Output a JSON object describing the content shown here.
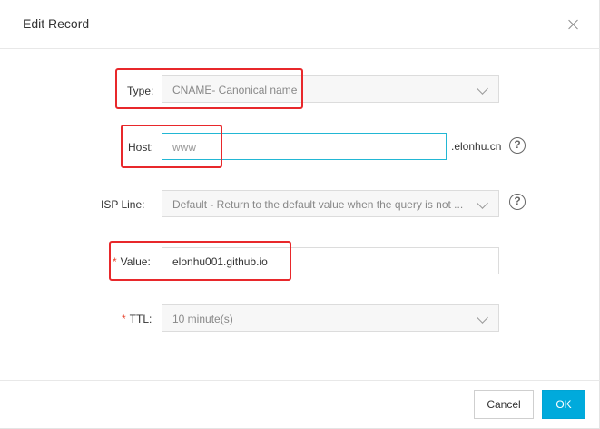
{
  "dialog": {
    "title": "Edit Record",
    "close_icon": "close-icon"
  },
  "form": {
    "type": {
      "label": "Type:",
      "value": "CNAME- Canonical name"
    },
    "host": {
      "label": "Host:",
      "value": "www",
      "suffix": ".elonhu.cn",
      "help_icon": "help-icon"
    },
    "isp_line": {
      "label": "ISP Line:",
      "value": "Default - Return to the default value when the query is not ...",
      "help_icon": "help-icon"
    },
    "value": {
      "required_mark": "*",
      "label": "Value:",
      "value": "elonhu001.github.io"
    },
    "ttl": {
      "required_mark": "*",
      "label": "TTL:",
      "value": "10 minute(s)"
    }
  },
  "footer": {
    "cancel_label": "Cancel",
    "ok_label": "OK"
  },
  "colors": {
    "accent": "#00aadc",
    "focus_border": "#22b7d4",
    "required": "#e6442e",
    "annotation": "#e8282b"
  }
}
